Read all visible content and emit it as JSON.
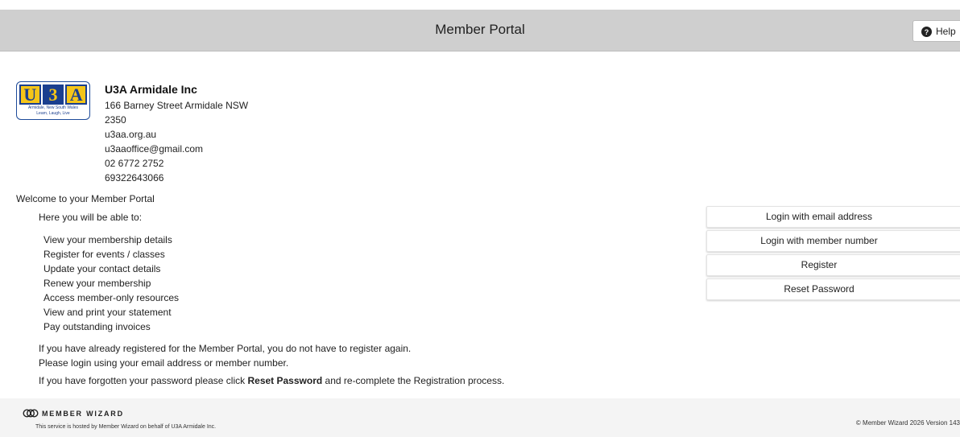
{
  "header": {
    "title": "Member Portal",
    "help_label": "Help"
  },
  "logo": {
    "letters": [
      "U",
      "3",
      "A"
    ],
    "sub1": "Armidale, New South Wales",
    "sub2": "Learn, Laugh, Live"
  },
  "org": {
    "name": "U3A Armidale Inc",
    "address": "166 Barney Street Armidale NSW",
    "postcode": "2350",
    "website": "u3aa.org.au",
    "email": "u3aaoffice@gmail.com",
    "phone": "02 6772 2752",
    "abn": "69322643066"
  },
  "content": {
    "welcome": "Welcome to your Member Portal",
    "able": "Here you will be able to:",
    "features": [
      "View your membership details",
      "Register for events / classes",
      "Update your contact details",
      "Renew your membership",
      "Access member-only resources",
      "View and print your statement",
      "Pay outstanding invoices"
    ],
    "already1": "If you have already registered for the Member Portal, you do not have to register again.",
    "already2": "Please login using your email address or member number.",
    "forgot_pre": "If you have forgotten your password please click ",
    "forgot_bold": "Reset Password",
    "forgot_post": " and re-complete the Registration process."
  },
  "actions": {
    "login_email": "Login with email address",
    "login_member": "Login with member number",
    "register": "Register",
    "reset": "Reset Password"
  },
  "footer": {
    "brand": "MEMBER WIZARD",
    "hosted": "This service is hosted by Member Wizard on behalf of U3A Armidale Inc.",
    "copyright": "© Member Wizard 2026 Version 143"
  }
}
